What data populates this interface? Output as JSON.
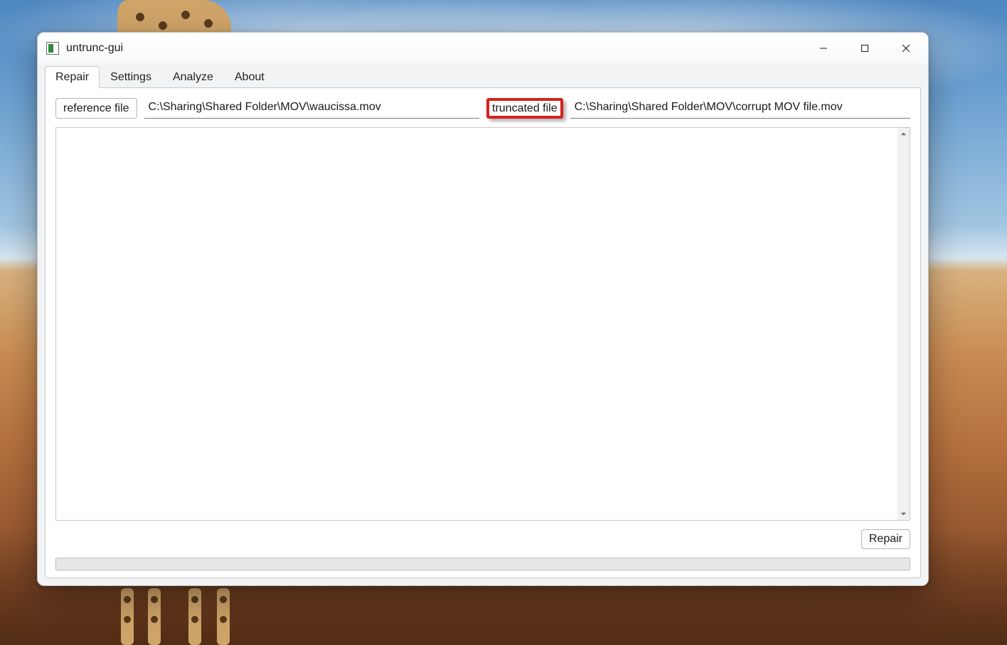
{
  "window": {
    "title": "untrunc-gui"
  },
  "tabs": {
    "items": [
      {
        "label": "Repair",
        "active": true
      },
      {
        "label": "Settings",
        "active": false
      },
      {
        "label": "Analyze",
        "active": false
      },
      {
        "label": "About",
        "active": false
      }
    ]
  },
  "repair": {
    "reference_button_label": "reference file",
    "reference_path": "C:\\Sharing\\Shared Folder\\MOV\\waucissa.mov",
    "truncated_button_label": "truncated file",
    "truncated_path": "C:\\Sharing\\Shared Folder\\MOV\\corrupt MOV file.mov",
    "log_text": "",
    "repair_button_label": "Repair",
    "progress_percent": 0
  },
  "annotation": {
    "highlighted_button": "truncated-file-button"
  }
}
